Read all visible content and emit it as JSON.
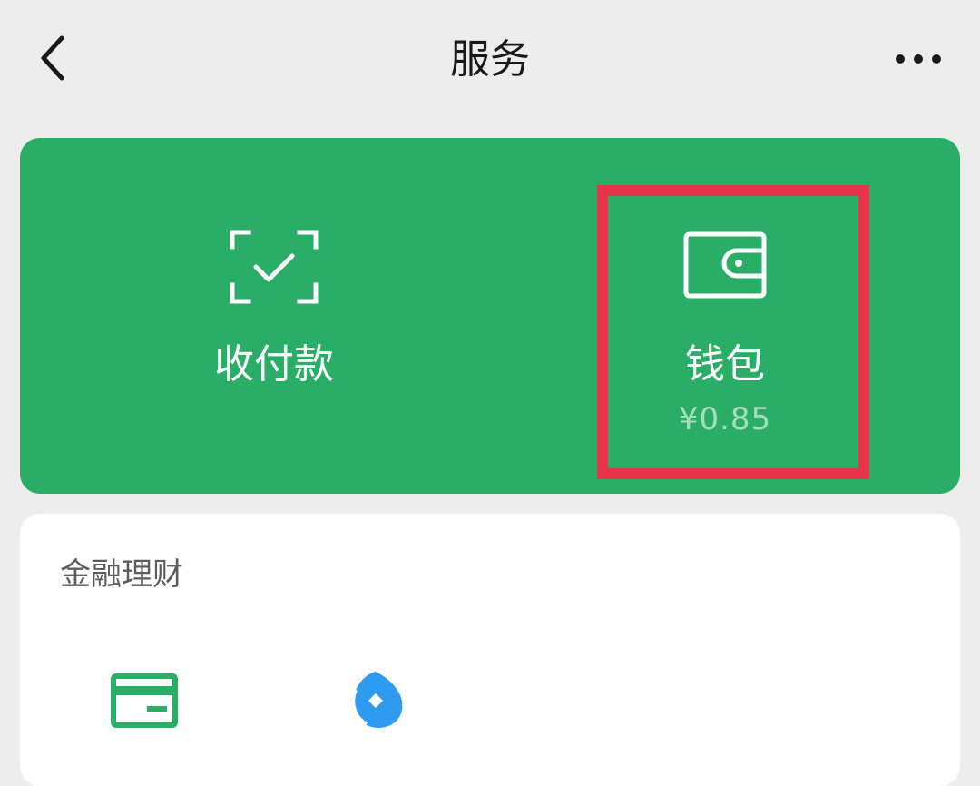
{
  "header": {
    "title": "服务",
    "back_icon": "chevron-left-icon",
    "more_icon": "more-horizontal-icon"
  },
  "main_card": {
    "background_color": "#2aae67",
    "items": [
      {
        "label": "收付款",
        "icon": "scan-check-icon"
      },
      {
        "label": "钱包",
        "balance": "¥0.85",
        "icon": "wallet-icon"
      }
    ],
    "highlight_color": "#e73449"
  },
  "finance_section": {
    "title": "金融理财",
    "items": [
      {
        "icon": "credit-card-icon"
      },
      {
        "icon": "wealth-drop-icon"
      }
    ]
  }
}
